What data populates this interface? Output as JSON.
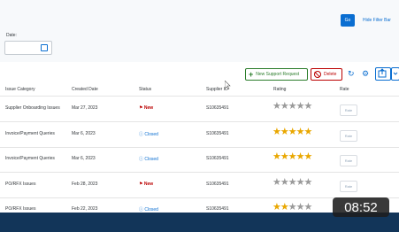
{
  "filter": {
    "go_label": "Go",
    "hide_filter_label": "Hide Filter Bar",
    "date_label": "Date:",
    "date_value": ""
  },
  "toolbar": {
    "add_label": "New Support Request",
    "delete_label": "Delete"
  },
  "table": {
    "headers": [
      "Issue Category",
      "Created Date",
      "Status",
      "Supplier ID",
      "Rating",
      "Rate"
    ],
    "rows": [
      {
        "category": "Supplier Onboarding Issues",
        "created": "Mar 27, 2023",
        "status": "New",
        "supplier": "S10635491",
        "rating": 0,
        "rate_label": "Rate"
      },
      {
        "category": "Invoice/Payment Queries",
        "created": "Mar 6, 2023",
        "status": "Closed",
        "supplier": "S10635491",
        "rating": 5,
        "rate_label": "Rate"
      },
      {
        "category": "Invoice/Payment Queries",
        "created": "Mar 6, 2023",
        "status": "Closed",
        "supplier": "S10635491",
        "rating": 5,
        "rate_label": "Rate"
      },
      {
        "category": "PO/RFX Issues",
        "created": "Feb 28, 2023",
        "status": "New",
        "supplier": "S10635491",
        "rating": 0,
        "rate_label": "Rate"
      },
      {
        "category": "PO/RFX Issues",
        "created": "Feb 22, 2023",
        "status": "Closed",
        "supplier": "S10635491",
        "rating": 2,
        "rate_label": "Rate"
      }
    ]
  },
  "video": {
    "timestamp": "08:52"
  },
  "colors": {
    "accent": "#0a6ed1",
    "danger": "#bb0000",
    "success": "#2b7d2b",
    "star": "#e9a700",
    "footer": "#123559"
  }
}
